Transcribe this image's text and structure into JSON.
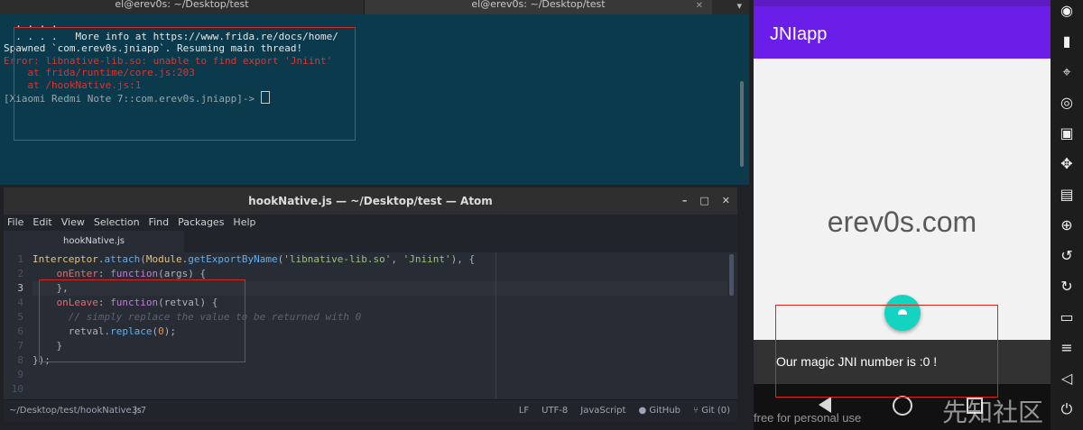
{
  "terminal": {
    "tab_left": "el@erev0s: ~/Desktop/test",
    "tab_right": "el@erev0s: ~/Desktop/test",
    "lines": [
      {
        "text": "  . . . .",
        "cls": "white"
      },
      {
        "text": "  . . . .   More info at https://www.frida.re/docs/home/",
        "cls": "white"
      },
      {
        "text": "Spawned `com.erev0s.jniapp`. Resuming main thread!",
        "cls": "white"
      },
      {
        "text": "Error: libnative-lib.so: unable to find export 'Jniint'",
        "cls": "red"
      },
      {
        "text": "    at frida/runtime/core.js:203",
        "cls": "red"
      },
      {
        "text": "    at /hookNative.js:1",
        "cls": "red"
      },
      {
        "text": "[Xiaomi Redmi Note 7::com.erev0s.jniapp]-> ",
        "cls": "gray"
      }
    ]
  },
  "atom": {
    "title": "hookNative.js — ~/Desktop/test — Atom",
    "menu": [
      "File",
      "Edit",
      "View",
      "Selection",
      "Find",
      "Packages",
      "Help"
    ],
    "tab_label": "hookNative.js",
    "line_numbers": [
      "1",
      "2",
      "3",
      "4",
      "5",
      "6",
      "7",
      "8",
      "9",
      "10"
    ],
    "code_lines": [
      [
        [
          "k-obj",
          "Interceptor"
        ],
        [
          "k-plain",
          "."
        ],
        [
          "k-fn",
          "attach"
        ],
        [
          "k-plain",
          "("
        ],
        [
          "k-obj",
          "Module"
        ],
        [
          "k-plain",
          "."
        ],
        [
          "k-fn",
          "getExportByName"
        ],
        [
          "k-plain",
          "("
        ],
        [
          "k-str",
          "'libnative-lib.so'"
        ],
        [
          "k-plain",
          ", "
        ],
        [
          "k-str",
          "'Jniint'"
        ],
        [
          "k-plain",
          "), {"
        ]
      ],
      [
        [
          "k-plain",
          "    "
        ],
        [
          "k-prop",
          "onEnter"
        ],
        [
          "k-plain",
          ": "
        ],
        [
          "k-kw",
          "function"
        ],
        [
          "k-plain",
          "(args) {"
        ]
      ],
      [
        [
          "k-plain",
          "    },"
        ]
      ],
      [
        [
          "k-plain",
          "    "
        ],
        [
          "k-prop",
          "onLeave"
        ],
        [
          "k-plain",
          ": "
        ],
        [
          "k-kw",
          "function"
        ],
        [
          "k-plain",
          "(retval) {"
        ]
      ],
      [
        [
          "k-com",
          "      // simply replace the value to be returned with 0"
        ]
      ],
      [
        [
          "k-plain",
          "      retval."
        ],
        [
          "k-fn",
          "replace"
        ],
        [
          "k-plain",
          "("
        ],
        [
          "k-num",
          "0"
        ],
        [
          "k-plain",
          ");"
        ]
      ],
      [
        [
          "k-plain",
          "    }"
        ]
      ],
      [
        [
          "k-plain",
          "});"
        ]
      ],
      [
        [
          "k-plain",
          ""
        ]
      ],
      [
        [
          "k-plain",
          ""
        ]
      ]
    ],
    "status": {
      "path": "~/Desktop/test/hookNative.js",
      "cursor": "3:7",
      "line_ending": "LF",
      "encoding": "UTF-8",
      "grammar": "JavaScript",
      "github": "GitHub",
      "git": "Git (0)"
    }
  },
  "phone": {
    "app_title": "JNIapp",
    "center_text": "erev0s.com",
    "snackbar_text": "Our magic JNI number is :0 !",
    "watermark_en": "free for personal use",
    "watermark_cn": "先知社区"
  },
  "sidebar_icons": [
    "camera-icon",
    "battery-icon",
    "gps-icon",
    "webcam-icon",
    "clapper-icon",
    "move-icon",
    "id-icon",
    "plus-circle-icon",
    "rotate-left-icon",
    "rotate-right-icon",
    "tablet-icon",
    "menu-icon",
    "back-icon",
    "power-icon"
  ]
}
